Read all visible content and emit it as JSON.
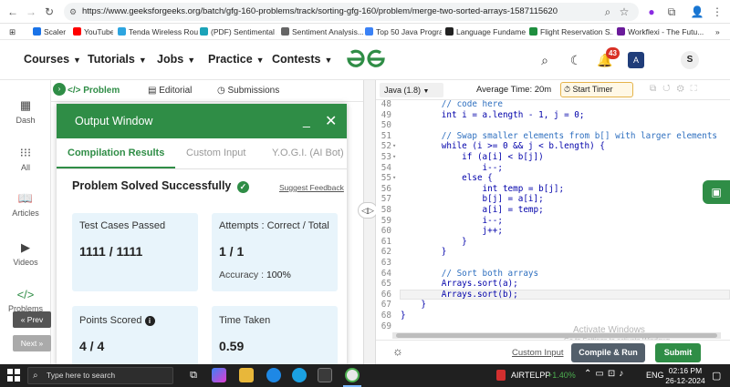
{
  "browser": {
    "url": "https://www.geeksforgeeks.org/batch/gfg-160-problems/track/sorting-gfg-160/problem/merge-two-sorted-arrays-1587115620",
    "bookmarks": [
      "Scaler",
      "YouTube",
      "Tenda Wireless Rout...",
      "(PDF) Sentimental A...",
      "Sentiment Analysis...",
      "Top 50 Java Progra...",
      "Language Fundame...",
      "Flight Reservation S...",
      "Workflexi - The Futu..."
    ],
    "bookmark_colors": [
      "#1a73e8",
      "#ff0000",
      "#2da5e0",
      "#1ba3b8",
      "#666666",
      "#3b82f6",
      "#222222",
      "#1e8e3e",
      "#6a1b9a"
    ]
  },
  "header": {
    "menus": [
      "Courses",
      "Tutorials",
      "Jobs",
      "Practice",
      "Contests"
    ],
    "logo_text": "GG",
    "notification_count": "43",
    "avatar_letter": "S",
    "brand_color": "#2f8d46"
  },
  "rail": {
    "items": [
      {
        "label": "Dash",
        "icon": "dashboard-icon"
      },
      {
        "label": "All",
        "icon": "grid-icon"
      },
      {
        "label": "Articles",
        "icon": "book-icon"
      },
      {
        "label": "Videos",
        "icon": "video-icon"
      },
      {
        "label": "Problems",
        "icon": "code-icon"
      }
    ],
    "prev_label": "« Prev",
    "next_label": "Next »"
  },
  "problem_tabs": {
    "problem": "Problem",
    "editorial": "Editorial",
    "submissions": "Submissions"
  },
  "output_window": {
    "title": "Output Window",
    "tabs": [
      "Compilation Results",
      "Custom Input",
      "Y.O.G.I. (AI Bot)"
    ],
    "status": "Problem Solved Successfully",
    "suggest_feedback": "Suggest Feedback",
    "test_cases_label": "Test Cases Passed",
    "test_cases_value": "1111 / 1111",
    "attempts_label": "Attempts : Correct / Total",
    "attempts_value": "1 / 1",
    "accuracy_label": "Accuracy :",
    "accuracy_value": "100%",
    "points_label": "Points Scored",
    "points_value": "4 / 4",
    "time_label": "Time Taken",
    "time_value": "0.59"
  },
  "editor": {
    "language": "Java (1.8)",
    "avg_time": "Average Time: 20m",
    "start_timer": "Start Timer",
    "lines": [
      {
        "n": "48",
        "fold": "",
        "text": "        // code here",
        "kind": "comment"
      },
      {
        "n": "49",
        "fold": "",
        "text": "        int i = a.length - 1, j = 0;",
        "kind": "code"
      },
      {
        "n": "50",
        "fold": "",
        "text": "",
        "kind": "code"
      },
      {
        "n": "51",
        "fold": "",
        "text": "        // Swap smaller elements from b[] with larger elements",
        "kind": "comment"
      },
      {
        "n": "52",
        "fold": "▾",
        "text": "        while (i >= 0 && j < b.length) {",
        "kind": "code"
      },
      {
        "n": "53",
        "fold": "▾",
        "text": "            if (a[i] < b[j])",
        "kind": "code"
      },
      {
        "n": "54",
        "fold": "",
        "text": "                i--;",
        "kind": "code"
      },
      {
        "n": "55",
        "fold": "▾",
        "text": "            else {",
        "kind": "code"
      },
      {
        "n": "56",
        "fold": "",
        "text": "                int temp = b[j];",
        "kind": "code"
      },
      {
        "n": "57",
        "fold": "",
        "text": "                b[j] = a[i];",
        "kind": "code"
      },
      {
        "n": "58",
        "fold": "",
        "text": "                a[i] = temp;",
        "kind": "code"
      },
      {
        "n": "59",
        "fold": "",
        "text": "                i--;",
        "kind": "code"
      },
      {
        "n": "60",
        "fold": "",
        "text": "                j++;",
        "kind": "code"
      },
      {
        "n": "61",
        "fold": "",
        "text": "            }",
        "kind": "code"
      },
      {
        "n": "62",
        "fold": "",
        "text": "        }",
        "kind": "code"
      },
      {
        "n": "63",
        "fold": "",
        "text": "",
        "kind": "code"
      },
      {
        "n": "64",
        "fold": "",
        "text": "        // Sort both arrays",
        "kind": "comment"
      },
      {
        "n": "65",
        "fold": "",
        "text": "        Arrays.sort(a);",
        "kind": "code"
      },
      {
        "n": "66",
        "fold": "",
        "text": "        Arrays.sort(b);",
        "kind": "code"
      },
      {
        "n": "67",
        "fold": "",
        "text": "    }",
        "kind": "code"
      },
      {
        "n": "68",
        "fold": "",
        "text": "}",
        "kind": "code"
      },
      {
        "n": "69",
        "fold": "",
        "text": "",
        "kind": "code"
      }
    ],
    "watermark_line1": "Activate Windows",
    "watermark_line2": "Go to Settings to activate Windows.",
    "custom_input": "Custom Input",
    "compile_run": "Compile & Run",
    "submit": "Submit"
  },
  "taskbar": {
    "search_placeholder": "Type here to search",
    "network": "AIRTELPP",
    "stock_change": "+1.40%",
    "language": "ENG",
    "time": "02:16 PM",
    "date": "26-12-2024"
  }
}
